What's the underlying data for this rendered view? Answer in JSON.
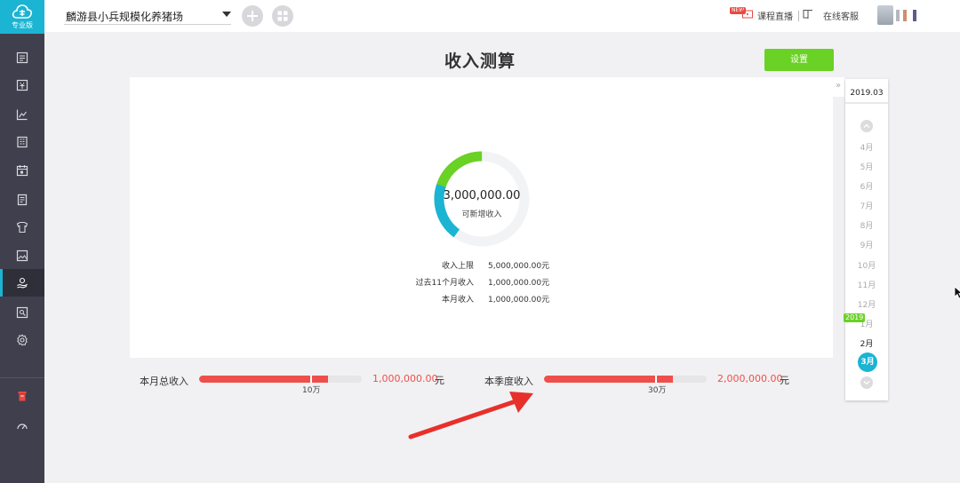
{
  "app": {
    "logo_text": "专业版",
    "farm_name": "麟游县小兵规模化养猪场"
  },
  "sidebar": {
    "items": [
      {
        "icon": "ledger-icon"
      },
      {
        "icon": "voucher-icon"
      },
      {
        "icon": "chart-icon"
      },
      {
        "icon": "building-icon"
      },
      {
        "icon": "calendar-icon"
      },
      {
        "icon": "document-icon"
      },
      {
        "icon": "tshirt-icon"
      },
      {
        "icon": "image-icon"
      },
      {
        "icon": "hand-coin-icon",
        "active": true
      },
      {
        "icon": "search-doc-icon"
      },
      {
        "icon": "gear-icon"
      }
    ],
    "bottom": [
      {
        "icon": "trash-icon"
      },
      {
        "icon": "dashboard-icon"
      }
    ]
  },
  "topbar": {
    "new_badge": "NEW",
    "live_course": "课程直播",
    "online_service": "在线客服"
  },
  "page": {
    "title": "收入测算",
    "settings_label": "设置"
  },
  "gauge": {
    "value": "3,000,000.00",
    "label": "可新增收入",
    "green_fraction": 0.2,
    "cyan_fraction": 0.2,
    "colors": {
      "green": "#6ad125",
      "cyan": "#1bb4d3",
      "track": "#f2f3f5"
    }
  },
  "stats": [
    {
      "label": "收入上限",
      "value": "5,000,000.00元"
    },
    {
      "label": "过去11个月收入",
      "value": "1,000,000.00元"
    },
    {
      "label": "本月收入",
      "value": "1,000,000.00元"
    }
  ],
  "summary": {
    "monthly": {
      "label": "本月总收入",
      "tick": "10万",
      "amount": "1,000,000.00",
      "unit": "元",
      "fill_fraction": 0.79
    },
    "quarterly": {
      "label": "本季度收入",
      "tick": "30万",
      "amount": "2,000,000.00",
      "unit": "元",
      "fill_fraction": 0.79
    }
  },
  "calendar": {
    "current": "2019.03",
    "months": [
      "4月",
      "5月",
      "6月",
      "7月",
      "8月",
      "9月",
      "10月",
      "11月",
      "12月",
      "1月",
      "2月",
      "3月"
    ],
    "year_tag": "2019",
    "selected": "3月"
  },
  "colors": {
    "accent": "#1bb4d3",
    "green": "#6ad125",
    "red": "#ef4f4a",
    "sidebar": "#3f3f4d"
  }
}
